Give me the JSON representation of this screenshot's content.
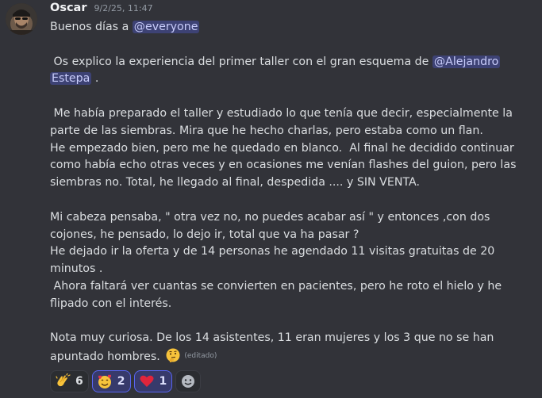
{
  "message": {
    "author": "Oscar",
    "timestamp": "9/2/25, 11:47",
    "lines": [
      {
        "text": "Buenos días a ",
        "mention": "@everyone"
      },
      {
        "text": ""
      },
      {
        "text": " Os explico la experiencia del primer taller con el gran esquema de ",
        "mention": "@Alejandro"
      },
      {
        "text": "",
        "mention": "Estepa",
        "after": " ."
      },
      {
        "text": ""
      },
      {
        "text": " Me había preparado el taller y estudiado lo que tenía que decir, especialmente la"
      },
      {
        "text": "parte de las siembras. Mira que he hecho charlas, pero estaba como un flan."
      },
      {
        "text": "He empezado bien, pero me he quedado en blanco.  Al final he decidido continuar"
      },
      {
        "text": "como había echo otras veces y en ocasiones me venían flashes del guion, pero las"
      },
      {
        "text": "siembras no. Total, he llegado al final, despedida .... y SIN VENTA."
      },
      {
        "text": ""
      },
      {
        "text": "Mi cabeza pensaba, \" otra vez no, no puedes acabar así \" y entonces ,con dos"
      },
      {
        "text": "cojones, he pensado, lo dejo ir, total que va ha pasar ?"
      },
      {
        "text": "He dejado ir la oferta y de 14 personas he agendado 11 visitas gratuitas de 20"
      },
      {
        "text": "minutos ."
      },
      {
        "text": " Ahora faltará ver cuantas se convierten en pacientes, pero he roto el hielo y he"
      },
      {
        "text": "flipado con el interés."
      },
      {
        "text": ""
      },
      {
        "text": "Nota muy curiosa. De los 14 asistentes, 11 eran mujeres y los 3 que no se han"
      },
      {
        "text": "apuntado hombres."
      }
    ],
    "edited_label": "(editado)",
    "inline_emoji": "thinking-face-icon"
  },
  "reactions": [
    {
      "icon": "clapping-hands-icon",
      "count": "6",
      "active": false
    },
    {
      "icon": "smiling-face-with-hearts-icon",
      "count": "2",
      "active": true
    },
    {
      "icon": "red-heart-icon",
      "count": "1",
      "active": true
    }
  ],
  "add_reaction_icon": "add-reaction-icon",
  "colors": {
    "background": "#323339",
    "mention_bg": "#3f427a",
    "mention_text": "#c9cdfb",
    "active_reaction_border": "#5865f2"
  }
}
